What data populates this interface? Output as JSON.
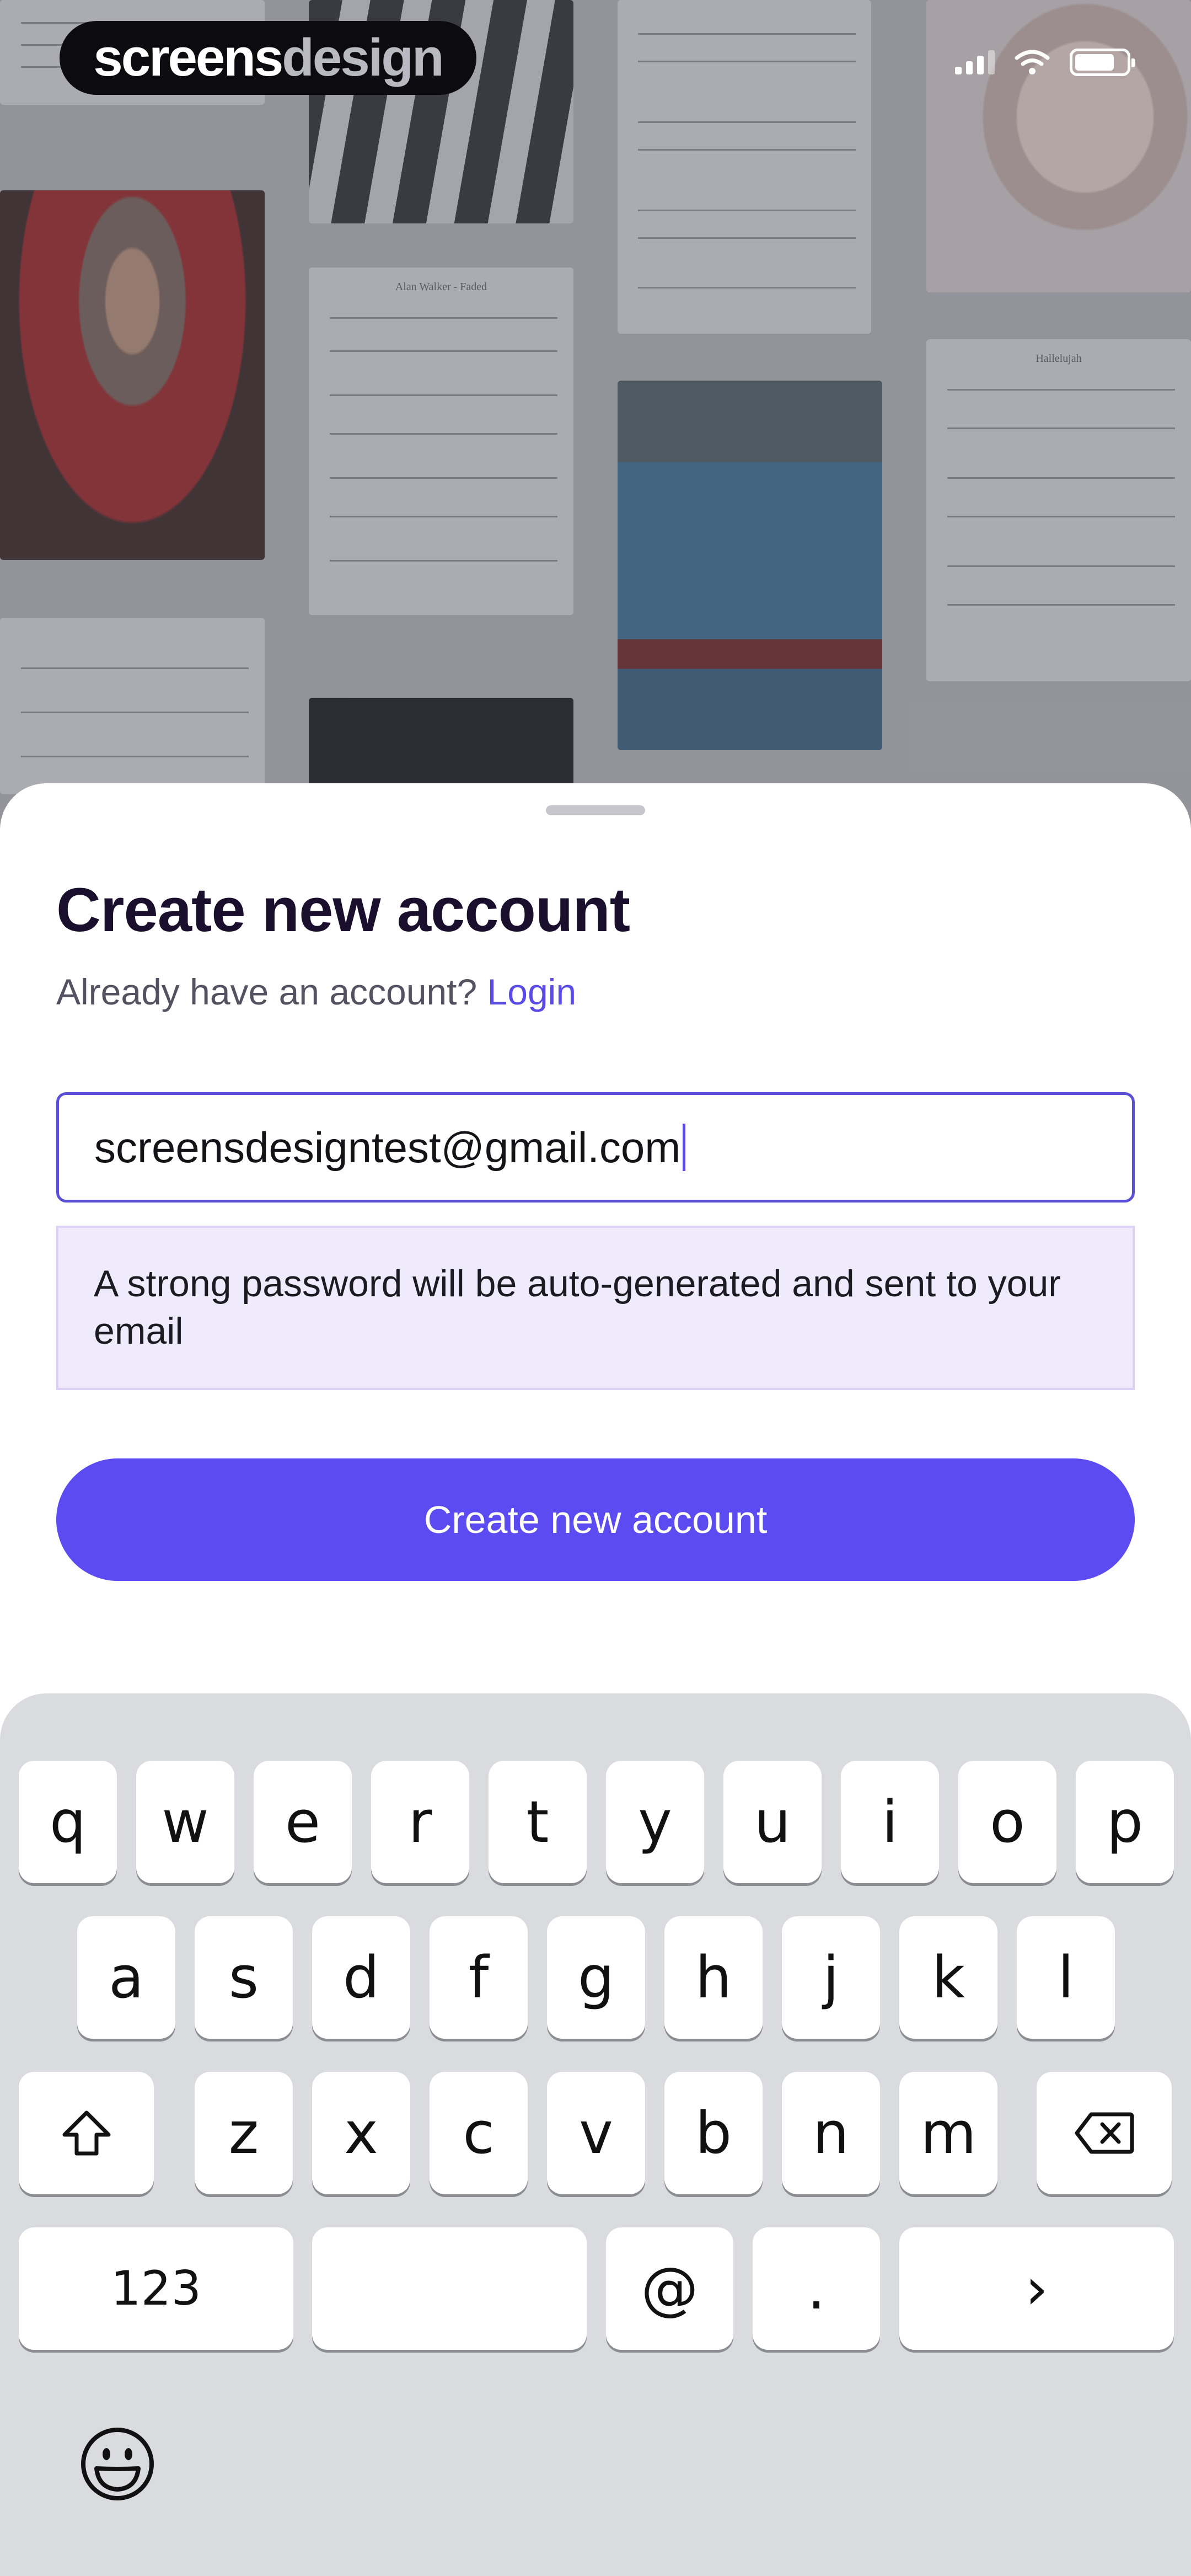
{
  "status_bar": {
    "brand": {
      "part1": "screens",
      "part2": "design"
    }
  },
  "signup": {
    "title": "Create new account",
    "subtitle": "Already have an account?",
    "login_link": "Login",
    "email_value": "screensdesigntest@gmail.com",
    "notice": "A strong password will be auto-generated and sent to your email",
    "create_button": "Create new account"
  },
  "background_sheets": {
    "sheet_a_title": "Alan Walker - Faded",
    "sheet_b_title": "Hallelujah"
  },
  "keyboard": {
    "row1": [
      "q",
      "w",
      "e",
      "r",
      "t",
      "y",
      "u",
      "i",
      "o",
      "p"
    ],
    "row2": [
      "a",
      "s",
      "d",
      "f",
      "g",
      "h",
      "j",
      "k",
      "l"
    ],
    "row3": [
      "z",
      "x",
      "c",
      "v",
      "b",
      "n",
      "m"
    ],
    "numbers_key": "123",
    "at_key": "@",
    "dot_key": ".",
    "next_key": "›",
    "icons": {
      "shift": "shift-icon",
      "delete": "delete-icon",
      "emoji": "emoji-icon"
    }
  },
  "colors": {
    "accent": "#5b4bf0",
    "title": "#1a0f2c",
    "notice_bg": "#f0eafd",
    "keyboard_bg": "#dadbdf"
  }
}
